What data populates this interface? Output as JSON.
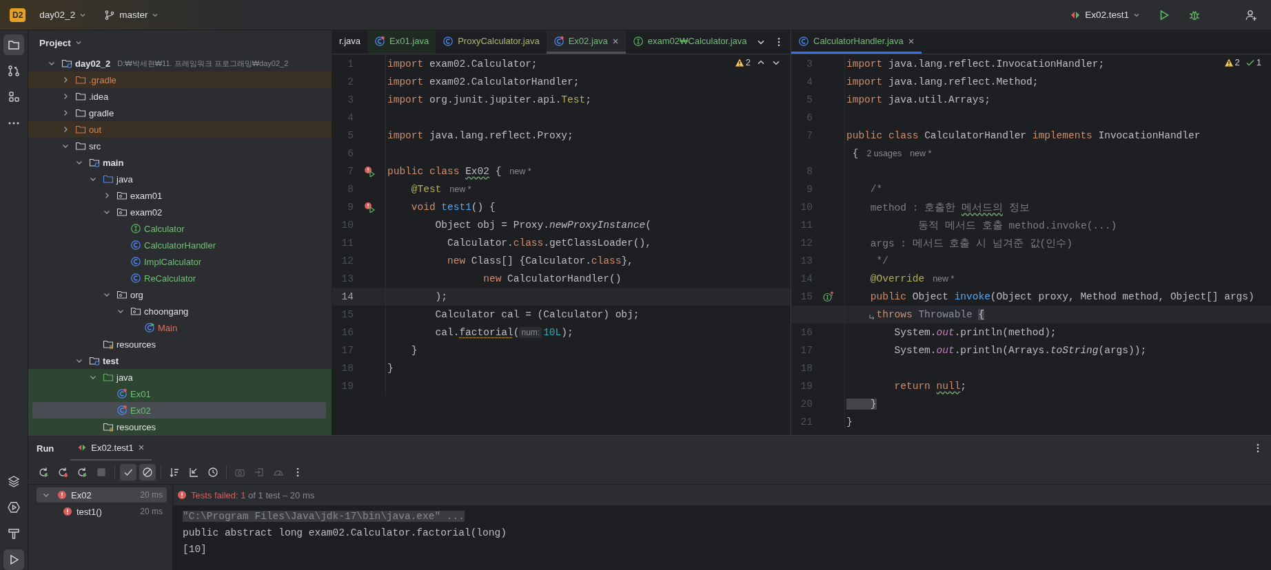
{
  "top_bar": {
    "project_badge": "D2",
    "project": "day02_2",
    "branch": "master",
    "run_config": "Ex02.test1"
  },
  "tool_strip": {
    "top": [
      {
        "kind": "project",
        "selected": true
      },
      {
        "kind": "commit",
        "selected": false
      },
      {
        "kind": "structure",
        "selected": false
      },
      {
        "kind": "more",
        "selected": false
      }
    ],
    "bottom": [
      {
        "kind": "layers",
        "selected": false
      },
      {
        "kind": "services",
        "selected": false
      },
      {
        "kind": "build",
        "selected": false
      },
      {
        "kind": "run",
        "selected": true
      }
    ]
  },
  "project_panel": {
    "title": "Project",
    "tree": [
      {
        "label": "day02_2",
        "path": "D:₩박세현₩11. 프레임워크 프로그래밍₩day02_2",
        "kind": "module",
        "expanded": true,
        "excluded": false,
        "test_source": false,
        "selected": false,
        "children": [
          {
            "label": ".gradle",
            "kind": "folder",
            "expanded": false,
            "excluded": true,
            "test_source": false,
            "selected": false
          },
          {
            "label": ".idea",
            "kind": "folder",
            "expanded": false,
            "excluded": false,
            "test_source": false,
            "selected": false
          },
          {
            "label": "gradle",
            "kind": "folder",
            "expanded": false,
            "excluded": false,
            "test_source": false,
            "selected": false
          },
          {
            "label": "out",
            "kind": "folder",
            "expanded": false,
            "excluded": true,
            "test_source": false,
            "selected": false
          },
          {
            "label": "src",
            "kind": "folder",
            "expanded": true,
            "excluded": false,
            "test_source": false,
            "selected": false,
            "children": [
              {
                "label": "main",
                "kind": "module_folder",
                "expanded": true,
                "excluded": false,
                "test_source": false,
                "selected": false,
                "children": [
                  {
                    "label": "java",
                    "kind": "source_root",
                    "expanded": true,
                    "excluded": false,
                    "test_source": false,
                    "selected": false,
                    "children": [
                      {
                        "label": "exam01",
                        "kind": "package",
                        "expanded": false,
                        "excluded": false,
                        "test_source": false,
                        "selected": false
                      },
                      {
                        "label": "exam02",
                        "kind": "package",
                        "expanded": true,
                        "excluded": false,
                        "test_source": false,
                        "selected": false,
                        "children": [
                          {
                            "label": "Calculator",
                            "kind": "interface",
                            "color": "#73bd79",
                            "excluded": false,
                            "test_source": false,
                            "selected": false
                          },
                          {
                            "label": "CalculatorHandler",
                            "kind": "class",
                            "color": "#73bd79",
                            "excluded": false,
                            "test_source": false,
                            "selected": false
                          },
                          {
                            "label": "ImplCalculator",
                            "kind": "class",
                            "color": "#73bd79",
                            "excluded": false,
                            "test_source": false,
                            "selected": false
                          },
                          {
                            "label": "ReCalculator",
                            "kind": "class",
                            "color": "#73bd79",
                            "excluded": false,
                            "test_source": false,
                            "selected": false
                          }
                        ]
                      },
                      {
                        "label": "org",
                        "kind": "package",
                        "expanded": true,
                        "excluded": false,
                        "test_source": false,
                        "selected": false,
                        "children": [
                          {
                            "label": "choongang",
                            "kind": "package",
                            "expanded": true,
                            "excluded": false,
                            "test_source": false,
                            "selected": false,
                            "children": [
                              {
                                "label": "Main",
                                "kind": "main_class",
                                "color": "#d9735f",
                                "excluded": false,
                                "test_source": false,
                                "selected": false
                              }
                            ]
                          }
                        ]
                      }
                    ]
                  },
                  {
                    "label": "resources",
                    "kind": "resources",
                    "excluded": false,
                    "test_source": false,
                    "selected": false
                  }
                ]
              },
              {
                "label": "test",
                "kind": "module_folder",
                "expanded": true,
                "excluded": false,
                "test_source": false,
                "selected": false,
                "children": [
                  {
                    "label": "java",
                    "kind": "test_root",
                    "expanded": true,
                    "excluded": false,
                    "test_source": true,
                    "selected": false,
                    "children": [
                      {
                        "label": "Ex01",
                        "kind": "test_class",
                        "color": "#73bd79",
                        "excluded": false,
                        "test_source": true,
                        "selected": false
                      },
                      {
                        "label": "Ex02",
                        "kind": "test_class",
                        "color": "#73bd79",
                        "excluded": false,
                        "test_source": true,
                        "selected": true
                      }
                    ]
                  },
                  {
                    "label": "resources",
                    "kind": "resources",
                    "excluded": false,
                    "test_source": true,
                    "selected": false
                  }
                ]
              }
            ]
          }
        ]
      }
    ]
  },
  "left_editor": {
    "tabs": [
      {
        "label": "r.java",
        "kind": "plain",
        "selected": false
      },
      {
        "label": "Ex01.java",
        "kind": "test_class",
        "color": "#73bd79",
        "selected": false
      },
      {
        "label": "ProxyCalculator.java",
        "kind": "class",
        "color": "#a8b86e",
        "selected": false
      },
      {
        "label": "Ex02.java",
        "kind": "test_class",
        "color": "#73bd79",
        "selected": true
      },
      {
        "label": "exam02₩Calculator.java",
        "kind": "interface",
        "color": "#73bd79",
        "selected": false
      }
    ],
    "warnings": "2",
    "lines": [
      {
        "no": "1",
        "kind": "plain",
        "current": false,
        "tokens": [
          {
            "kind": "kw",
            "text": "import "
          },
          {
            "kind": "plain",
            "text": "exam02.Calculator;"
          }
        ]
      },
      {
        "no": "2",
        "kind": "plain",
        "current": false,
        "tokens": [
          {
            "kind": "kw",
            "text": "import "
          },
          {
            "kind": "plain",
            "text": "exam02.CalculatorHandler;"
          }
        ]
      },
      {
        "no": "3",
        "kind": "plain",
        "current": false,
        "tokens": [
          {
            "kind": "kw",
            "text": "import "
          },
          {
            "kind": "plain",
            "text": "org.junit.jupiter.api."
          },
          {
            "kind": "type",
            "text": "Test"
          },
          {
            "kind": "plain",
            "text": ";"
          }
        ]
      },
      {
        "no": "4",
        "kind": "plain",
        "current": false
      },
      {
        "no": "5",
        "kind": "plain",
        "current": false,
        "tokens": [
          {
            "kind": "kw",
            "text": "import "
          },
          {
            "kind": "plain",
            "text": "java.lang.reflect.Proxy;"
          }
        ]
      },
      {
        "no": "6",
        "kind": "plain",
        "current": false
      },
      {
        "no": "7",
        "kind": "test_failed",
        "current": false,
        "tokens": [
          {
            "kind": "kw",
            "text": "public class "
          },
          {
            "kind": "typo",
            "text": "Ex02"
          },
          {
            "kind": "plain",
            "text": " {"
          },
          {
            "kind": "hint",
            "text": "new *"
          }
        ]
      },
      {
        "no": "8",
        "kind": "plain",
        "current": false,
        "tokens": [
          {
            "kind": "ann",
            "text": "    @Test"
          },
          {
            "kind": "hint",
            "text": "new *"
          }
        ]
      },
      {
        "no": "9",
        "kind": "test_failed",
        "current": false,
        "tokens": [
          {
            "kind": "kw",
            "text": "    void "
          },
          {
            "kind": "decl",
            "text": "test1"
          },
          {
            "kind": "plain",
            "text": "() {"
          }
        ]
      },
      {
        "no": "10",
        "kind": "plain",
        "current": false,
        "tokens": [
          {
            "kind": "plain",
            "text": "        Object obj = Proxy."
          },
          {
            "kind": "italic",
            "text": "newProxyInstance"
          },
          {
            "kind": "plain",
            "text": "("
          }
        ]
      },
      {
        "no": "11",
        "kind": "plain",
        "current": false,
        "tokens": [
          {
            "kind": "plain",
            "text": "          Calculator."
          },
          {
            "kind": "kw",
            "text": "class"
          },
          {
            "kind": "plain",
            "text": ".getClassLoader(),"
          }
        ]
      },
      {
        "no": "12",
        "kind": "plain",
        "current": false,
        "tokens": [
          {
            "kind": "kw",
            "text": "          new"
          },
          {
            "kind": "plain",
            "text": " Class[] {Calculator."
          },
          {
            "kind": "kw",
            "text": "class"
          },
          {
            "kind": "plain",
            "text": "},"
          }
        ]
      },
      {
        "no": "13",
        "kind": "plain",
        "current": false,
        "tokens": [
          {
            "kind": "kw",
            "text": "                new"
          },
          {
            "kind": "plain",
            "text": " CalculatorHandler()"
          }
        ]
      },
      {
        "no": "14",
        "kind": "plain",
        "current": true,
        "tokens": [
          {
            "kind": "plain",
            "text": "        );"
          }
        ]
      },
      {
        "no": "15",
        "kind": "plain",
        "current": false,
        "tokens": [
          {
            "kind": "plain",
            "text": "        Calculator cal = (Calculator) obj;"
          }
        ]
      },
      {
        "no": "16",
        "kind": "plain",
        "current": false,
        "tokens": [
          {
            "kind": "plain",
            "text": "        cal."
          },
          {
            "kind": "warn",
            "text": "factorial"
          },
          {
            "kind": "plain",
            "text": "("
          },
          {
            "kind": "param_hint",
            "text": "num:"
          },
          {
            "kind": "num",
            "text": "10L"
          },
          {
            "kind": "plain",
            "text": ");"
          }
        ]
      },
      {
        "no": "17",
        "kind": "plain",
        "current": false,
        "tokens": [
          {
            "kind": "plain",
            "text": "    }"
          }
        ]
      },
      {
        "no": "18",
        "kind": "plain",
        "current": false,
        "tokens": [
          {
            "kind": "plain",
            "text": "}"
          }
        ]
      },
      {
        "no": "19",
        "kind": "plain",
        "current": false
      }
    ]
  },
  "right_editor": {
    "tabs": [
      {
        "label": "CalculatorHandler.java",
        "kind": "class",
        "color": "#73bd79",
        "selected": true
      }
    ],
    "warnings": "2",
    "passed": "1",
    "lines": [
      {
        "no": "3",
        "kind": "plain",
        "current": false,
        "tokens": [
          {
            "kind": "kw",
            "text": "import "
          },
          {
            "kind": "plain",
            "text": "java.lang.reflect.InvocationHandler;"
          }
        ]
      },
      {
        "no": "4",
        "kind": "plain",
        "current": false,
        "tokens": [
          {
            "kind": "kw",
            "text": "import "
          },
          {
            "kind": "plain",
            "text": "java.lang.reflect.Method;"
          }
        ]
      },
      {
        "no": "5",
        "kind": "plain",
        "current": false,
        "tokens": [
          {
            "kind": "kw",
            "text": "import "
          },
          {
            "kind": "plain",
            "text": "java.util.Arrays;"
          }
        ]
      },
      {
        "no": "6",
        "kind": "plain",
        "current": false
      },
      {
        "no": "7",
        "kind": "plain",
        "current": false,
        "tokens": [
          {
            "kind": "kw",
            "text": "public class "
          },
          {
            "kind": "plain",
            "text": "CalculatorHandler "
          },
          {
            "kind": "kw",
            "text": "implements "
          },
          {
            "kind": "plain",
            "text": "InvocationHandler"
          }
        ]
      },
      {
        "kind": "plain",
        "current": false,
        "tokens": [
          {
            "kind": "plain",
            "text": " {"
          },
          {
            "kind": "hint",
            "text": "2 usages"
          },
          {
            "kind": "hint",
            "text": "new *"
          }
        ]
      },
      {
        "no": "8",
        "kind": "plain",
        "current": false
      },
      {
        "no": "9",
        "kind": "plain",
        "current": false,
        "tokens": [
          {
            "kind": "comment",
            "text": "    /*"
          }
        ]
      },
      {
        "no": "10",
        "kind": "plain",
        "current": false,
        "tokens": [
          {
            "kind": "comment",
            "text": "    method : 호출한 "
          },
          {
            "kind": "comment_typo",
            "text": "메서드의"
          },
          {
            "kind": "comment",
            "text": " 정보"
          }
        ]
      },
      {
        "no": "11",
        "kind": "plain",
        "current": false,
        "tokens": [
          {
            "kind": "comment",
            "text": "            동적 메서드 호출 method.invoke(...)"
          }
        ]
      },
      {
        "no": "12",
        "kind": "plain",
        "current": false,
        "tokens": [
          {
            "kind": "comment",
            "text": "    args : 메서드 호출 시 넘겨준 값(인수)"
          }
        ]
      },
      {
        "no": "13",
        "kind": "plain",
        "current": false,
        "tokens": [
          {
            "kind": "comment",
            "text": "     */"
          }
        ]
      },
      {
        "no": "14",
        "kind": "plain",
        "current": false,
        "tokens": [
          {
            "kind": "ann",
            "text": "    @Override"
          },
          {
            "kind": "hint",
            "text": "new *"
          }
        ]
      },
      {
        "no": "15",
        "kind": "implements",
        "current": false,
        "tokens": [
          {
            "kind": "kw",
            "text": "    public "
          },
          {
            "kind": "plain",
            "text": "Object "
          },
          {
            "kind": "decl",
            "text": "invoke"
          },
          {
            "kind": "plain",
            "text": "(Object proxy, Method method, Object[] args)"
          }
        ]
      },
      {
        "kind": "soft_wrap",
        "current": true,
        "tokens": [
          {
            "kind": "kw",
            "text": "     throws "
          },
          {
            "kind": "dim",
            "text": "Throwable "
          },
          {
            "kind": "brace",
            "text": "{"
          }
        ]
      },
      {
        "no": "16",
        "kind": "plain",
        "current": false,
        "tokens": [
          {
            "kind": "plain",
            "text": "        System."
          },
          {
            "kind": "field",
            "text": "out"
          },
          {
            "kind": "plain",
            "text": ".println(method);"
          }
        ]
      },
      {
        "no": "17",
        "kind": "plain",
        "current": false,
        "tokens": [
          {
            "kind": "plain",
            "text": "        System."
          },
          {
            "kind": "field",
            "text": "out"
          },
          {
            "kind": "plain",
            "text": ".println(Arrays."
          },
          {
            "kind": "italic",
            "text": "toString"
          },
          {
            "kind": "plain",
            "text": "(args));"
          }
        ]
      },
      {
        "no": "18",
        "kind": "plain",
        "current": false
      },
      {
        "no": "19",
        "kind": "plain",
        "current": false,
        "tokens": [
          {
            "kind": "kw",
            "text": "        return "
          },
          {
            "kind": "kw_typo",
            "text": "null"
          },
          {
            "kind": "plain",
            "text": ";"
          }
        ]
      },
      {
        "no": "20",
        "kind": "plain",
        "current": false,
        "tokens": [
          {
            "kind": "brace",
            "text": "    }"
          }
        ]
      },
      {
        "no": "21",
        "kind": "plain",
        "current": false,
        "tokens": [
          {
            "kind": "plain",
            "text": "}"
          }
        ]
      }
    ]
  },
  "run_panel": {
    "title": "Run",
    "tabs": [
      {
        "label": "Ex02.test1",
        "selected": true
      }
    ],
    "toolbar": [
      {
        "kind": "rerun",
        "on": false,
        "disabled": false
      },
      {
        "kind": "rerun_failed",
        "on": false,
        "disabled": false
      },
      {
        "kind": "auto_rerun",
        "on": false,
        "disabled": false
      },
      {
        "kind": "stop",
        "on": false,
        "disabled": true
      },
      {
        "kind": "show_passed",
        "on": true,
        "disabled": false
      },
      {
        "kind": "show_ignored",
        "on": true,
        "disabled": false
      },
      {
        "kind": "sort",
        "on": false,
        "disabled": false
      },
      {
        "kind": "collapse",
        "on": false,
        "disabled": false
      },
      {
        "kind": "history",
        "on": false,
        "disabled": false
      },
      {
        "kind": "camera",
        "on": false,
        "disabled": true
      },
      {
        "kind": "export",
        "on": false,
        "disabled": true
      },
      {
        "kind": "gauge",
        "on": false,
        "disabled": true
      },
      {
        "kind": "more",
        "on": false,
        "disabled": false
      }
    ],
    "tests": [
      {
        "label": "Ex02",
        "time": "20 ms",
        "failed": true,
        "expanded": true,
        "selected": true,
        "children": [
          {
            "label": "test1()",
            "time": "20 ms",
            "failed": true,
            "selected": false
          }
        ]
      }
    ],
    "summary": {
      "label": "Tests failed:",
      "failed": "1",
      "rest": "of 1 test – 20 ms"
    },
    "console": [
      {
        "kind": "command",
        "text": "\"C:\\Program Files\\Java\\jdk-17\\bin\\java.exe\" ..."
      },
      {
        "kind": "output",
        "text": "public abstract long exam02.Calculator.factorial(long)"
      },
      {
        "kind": "output",
        "text": "[10]"
      }
    ]
  }
}
